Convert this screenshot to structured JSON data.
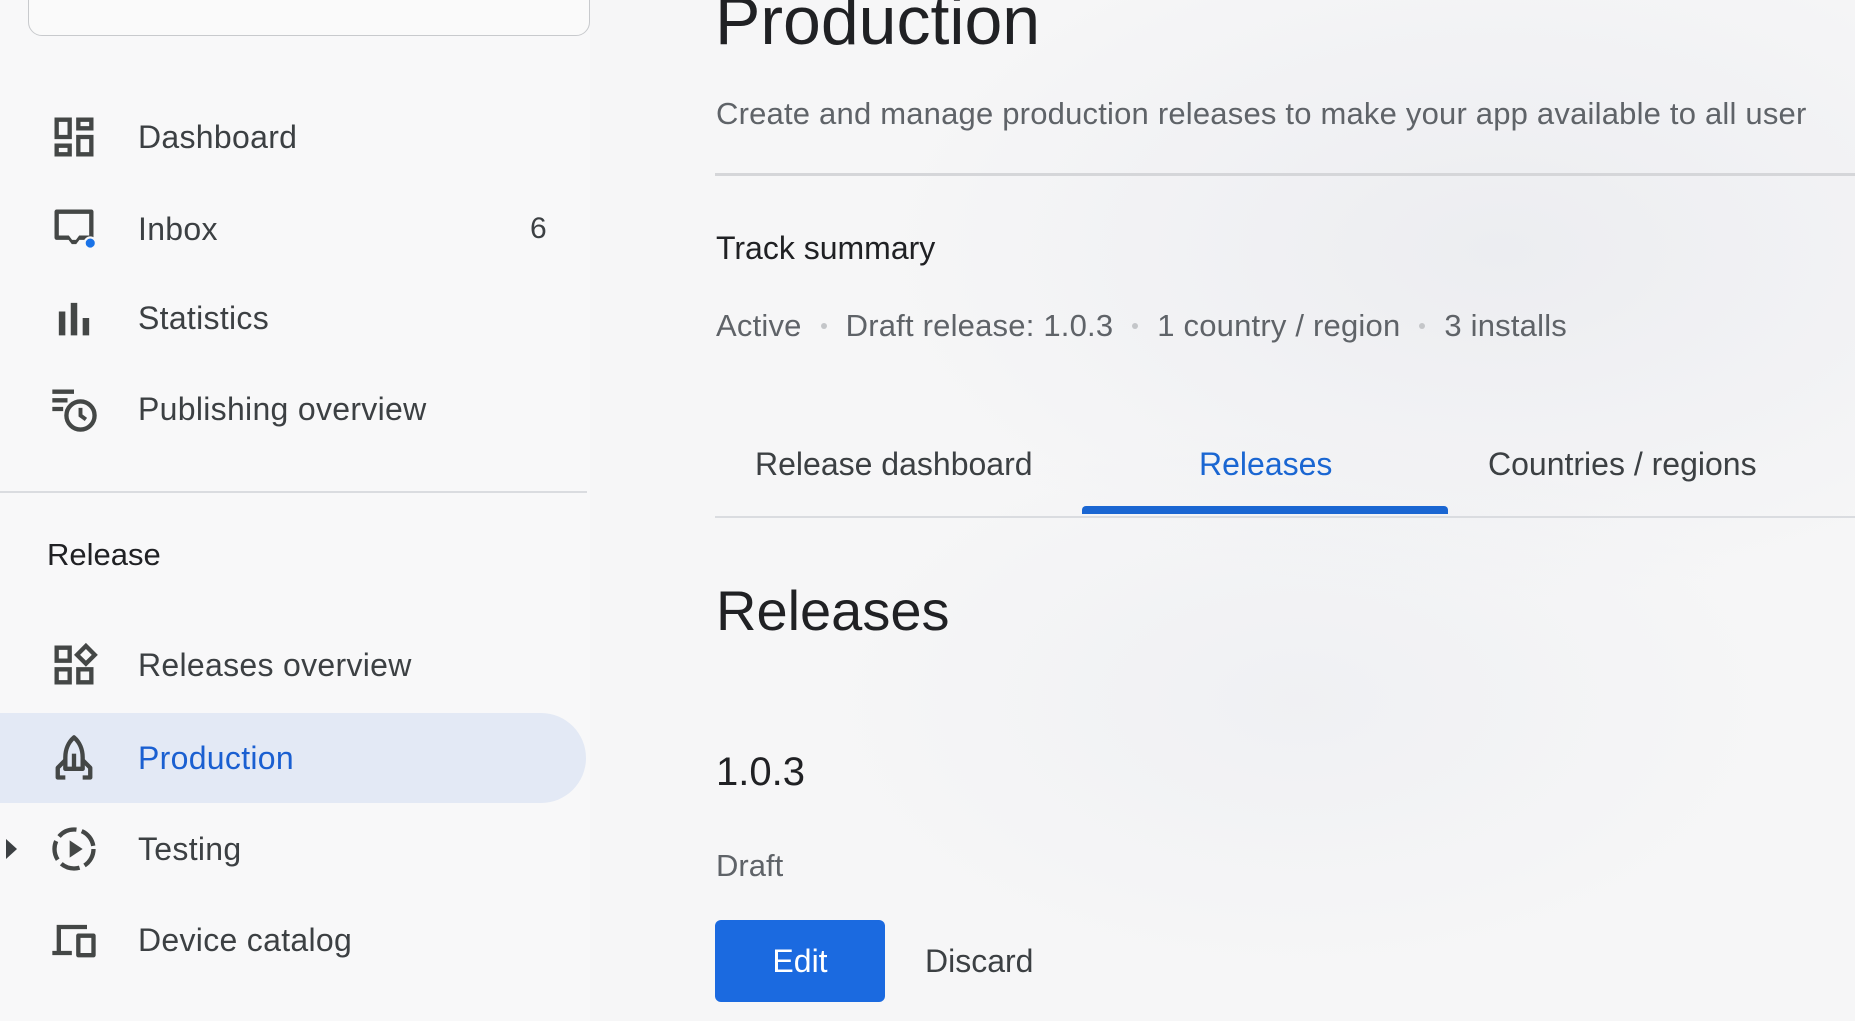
{
  "sidebar": {
    "items": [
      {
        "label": "Dashboard",
        "icon": "dashboard-icon"
      },
      {
        "label": "Inbox",
        "icon": "inbox-icon",
        "count": "6"
      },
      {
        "label": "Statistics",
        "icon": "statistics-icon"
      },
      {
        "label": "Publishing overview",
        "icon": "publishing-overview-icon"
      }
    ],
    "section_title": "Release",
    "release_items": [
      {
        "label": "Releases overview",
        "icon": "releases-overview-icon"
      },
      {
        "label": "Production",
        "icon": "production-icon",
        "active": true
      },
      {
        "label": "Testing",
        "icon": "testing-icon"
      },
      {
        "label": "Device catalog",
        "icon": "device-catalog-icon"
      }
    ]
  },
  "main": {
    "title": "Production",
    "subtitle": "Create and manage production releases to make your app available to all user",
    "track_summary": {
      "title": "Track summary",
      "status": "Active",
      "draft_release": "Draft release: 1.0.3",
      "countries": "1 country / region",
      "installs": "3 installs"
    },
    "tabs": [
      {
        "label": "Release dashboard"
      },
      {
        "label": "Releases",
        "active": true
      },
      {
        "label": "Countries / regions"
      }
    ],
    "releases": {
      "heading": "Releases",
      "version": "1.0.3",
      "status": "Draft",
      "edit_label": "Edit",
      "discard_label": "Discard"
    }
  },
  "colors": {
    "accent": "#1a66d2",
    "active_nav_bg": "#e3e9f5",
    "notification_dot": "#1a73e8",
    "primary_button": "#1b6ae0"
  }
}
